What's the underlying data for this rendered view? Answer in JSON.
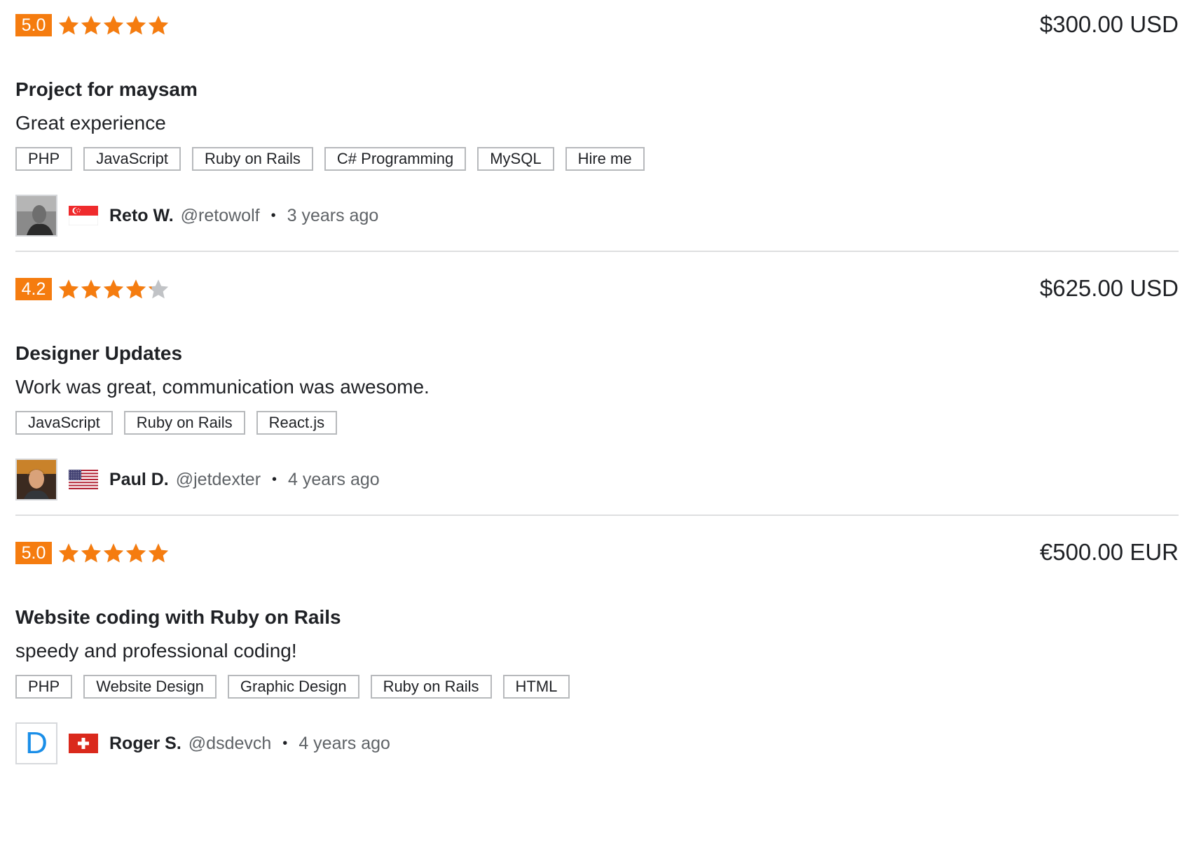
{
  "colors": {
    "accent": "#f57c0f",
    "star_empty": "#c1c3c6",
    "link": "#1a8ee8"
  },
  "reviews": [
    {
      "score": "5.0",
      "rating": 5,
      "price": "$300.00 USD",
      "title": "Project for maysam",
      "comment": "Great experience",
      "tags": [
        "PHP",
        "JavaScript",
        "Ruby on Rails",
        "C# Programming",
        "MySQL",
        "Hire me"
      ],
      "reviewer": {
        "name": "Reto W.",
        "handle": "@retowolf",
        "time_ago": "3 years ago",
        "flag": "singapore-flag-icon",
        "avatar": "photo"
      }
    },
    {
      "score": "4.2",
      "rating": 4.2,
      "price": "$625.00 USD",
      "title": "Designer Updates",
      "comment": "Work was great, communication was awesome.",
      "tags": [
        "JavaScript",
        "Ruby on Rails",
        "React.js"
      ],
      "reviewer": {
        "name": "Paul D.",
        "handle": "@jetdexter",
        "time_ago": "4 years ago",
        "flag": "usa-flag-icon",
        "avatar": "photo"
      }
    },
    {
      "score": "5.0",
      "rating": 5,
      "price": "€500.00 EUR",
      "title": "Website coding with Ruby on Rails",
      "comment": "speedy and professional coding!",
      "tags": [
        "PHP",
        "Website Design",
        "Graphic Design",
        "Ruby on Rails",
        "HTML"
      ],
      "reviewer": {
        "name": "Roger S.",
        "handle": "@dsdevch",
        "time_ago": "4 years ago",
        "flag": "switzerland-flag-icon",
        "avatar": "letter",
        "avatar_letter": "D"
      }
    }
  ]
}
